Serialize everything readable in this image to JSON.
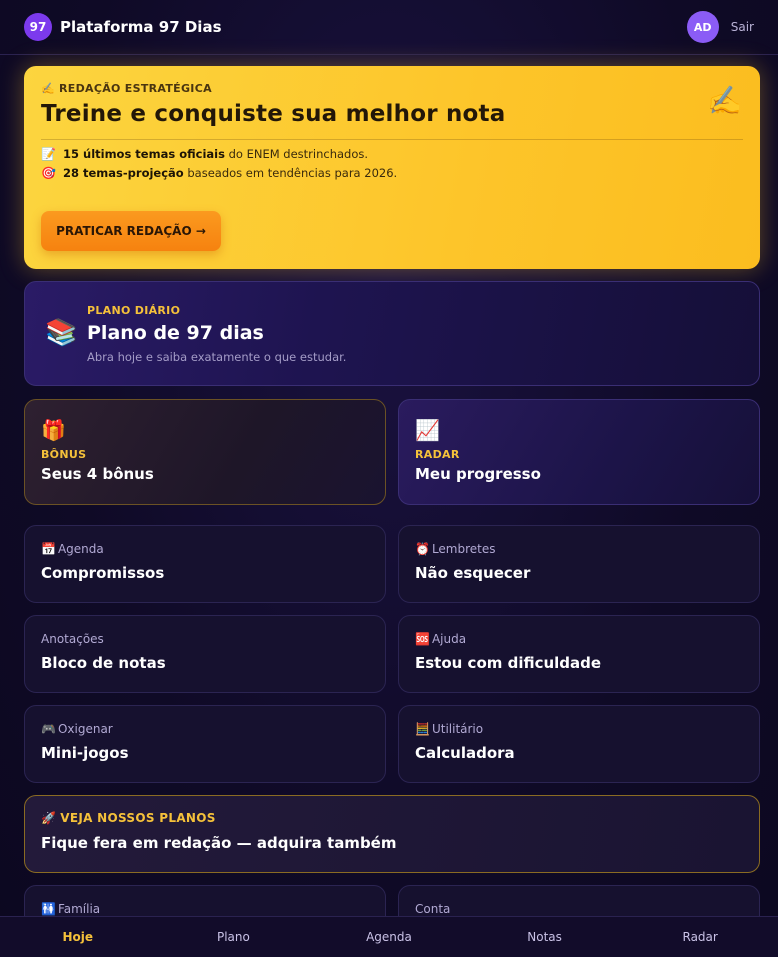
{
  "header": {
    "logo_badge": "97",
    "brand": "Plataforma 97 Dias",
    "avatar_initials": "AD",
    "logout_label": "Sair"
  },
  "hero": {
    "kicker_icon": "writing-hand-icon",
    "kicker": "REDAÇÃO ESTRATÉGICA",
    "title": "Treine e conquiste sua melhor nota",
    "corner_icon": "writing-hand-icon",
    "line1_icon": "memo-icon",
    "line1_bold": "15 últimos temas oficiais",
    "line1_rest": "do ENEM destrinchados.",
    "line2_icon": "target-icon",
    "line2_bold": "28 temas-projeção",
    "line2_rest": "baseados em tendências para 2026.",
    "button_label": "PRATICAR REDAÇÃO →"
  },
  "plan": {
    "icon": "books-icon",
    "kicker": "PLANO DIÁRIO",
    "title": "Plano de 97 dias",
    "subtitle": "Abra hoje e saiba exatamente o que estudar."
  },
  "features": {
    "bonus": {
      "icon": "gift-icon",
      "kicker": "BÔNUS",
      "title": "Seus 4 bônus"
    },
    "radar": {
      "icon": "chart-up-icon",
      "kicker": "RADAR",
      "title": "Meu progresso"
    }
  },
  "tiles": [
    {
      "icon": "calendar-icon",
      "kicker": "Agenda",
      "title": "Compromissos"
    },
    {
      "icon": "alarm-clock-icon",
      "kicker": "Lembretes",
      "title": "Não esquecer"
    },
    {
      "icon": "",
      "kicker": "Anotações",
      "title": "Bloco de notas"
    },
    {
      "icon": "sos-icon",
      "kicker": "Ajuda",
      "title": "Estou com dificuldade"
    },
    {
      "icon": "gamepad-icon",
      "kicker": "Oxigenar",
      "title": "Mini-jogos"
    },
    {
      "icon": "abacus-icon",
      "kicker": "Utilitário",
      "title": "Calculadora"
    }
  ],
  "banner": {
    "icon": "rocket-icon",
    "kicker": "VEJA NOSSOS PLANOS",
    "title": "Fique fera em redação — adquira também"
  },
  "tiles_bottom": [
    {
      "icon": "family-icon",
      "kicker": "Família"
    },
    {
      "icon": "",
      "kicker": "Conta"
    }
  ],
  "bottom_nav": [
    "Hoje",
    "Plano",
    "Agenda",
    "Notas",
    "Radar"
  ],
  "colors": {
    "accent": "#f5c13a",
    "hero_bg": "#fdc52a",
    "button": "#f6820f",
    "background": "#0f0a26",
    "logo": "#7c3aed"
  }
}
